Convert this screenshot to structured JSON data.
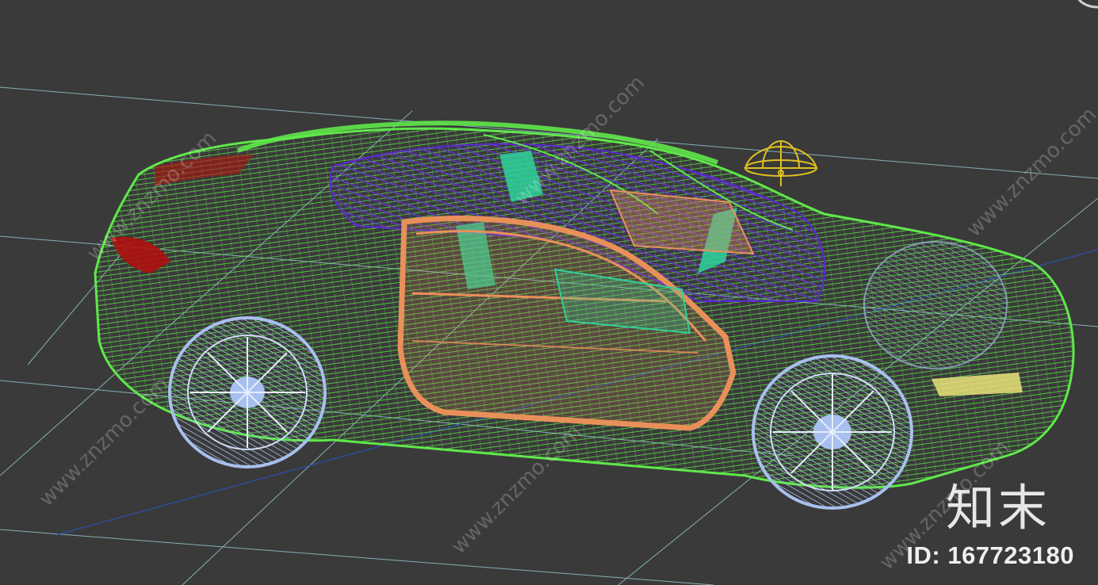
{
  "watermark": {
    "logo_text": "知末",
    "id_text": "ID: 167723180",
    "site_text": "www.znzmo.com"
  },
  "viewport": {
    "background_color": "#3a3a3a",
    "grid_color": "#9fd8e0",
    "axis_color": "#2f4fa8"
  },
  "model": {
    "body_color": "#5fe84a",
    "door_color": "#e8905a",
    "interior_color": "#5a2ad0",
    "seat_color": "#2ed39a",
    "wheel_color": "#a8c0ee",
    "taillight_color": "#b01010",
    "headlight_color": "#e9e27a",
    "light_gizmo_color": "#e0c020"
  },
  "icons": {
    "light": "omni-light-icon",
    "view_gizmo": "view-cube-icon"
  }
}
